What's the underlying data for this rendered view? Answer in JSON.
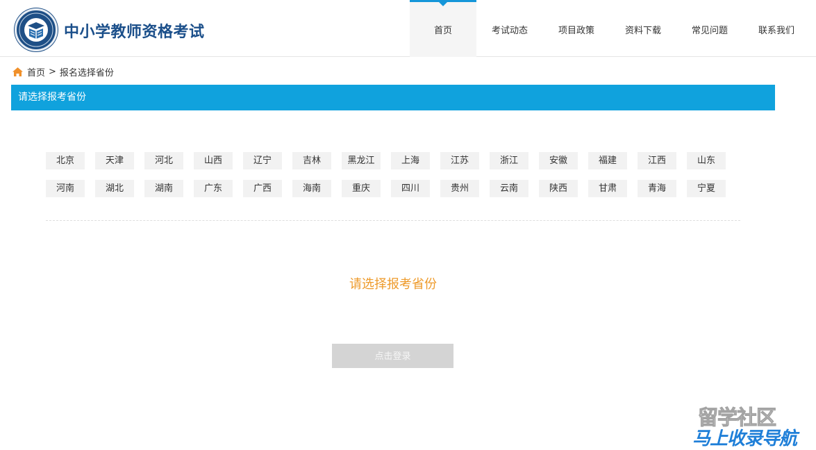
{
  "header": {
    "site_title": "中小学教师资格考试",
    "logo_icon": "book-emblem-icon"
  },
  "nav": {
    "items": [
      {
        "label": "首页",
        "active": true
      },
      {
        "label": "考试动态",
        "active": false
      },
      {
        "label": "项目政策",
        "active": false
      },
      {
        "label": "资料下载",
        "active": false
      },
      {
        "label": "常见问题",
        "active": false
      },
      {
        "label": "联系我们",
        "active": false
      }
    ],
    "accent_color": "#1596d9"
  },
  "breadcrumb": {
    "icon": "home-icon",
    "home": "首页",
    "separator": ">",
    "current": "报名选择省份"
  },
  "section_bar": {
    "title": "请选择报考省份",
    "color": "#10a2dd"
  },
  "provinces": {
    "row1": [
      "北京",
      "天津",
      "河北",
      "山西",
      "辽宁",
      "吉林",
      "黑龙江",
      "上海",
      "江苏",
      "浙江",
      "安徽",
      "福建",
      "江西",
      "山东"
    ],
    "row2": [
      "河南",
      "湖北",
      "湖南",
      "广东",
      "广西",
      "海南",
      "重庆",
      "四川",
      "贵州",
      "云南",
      "陕西",
      "甘肃",
      "青海",
      "宁夏"
    ]
  },
  "prompt": {
    "text": "请选择报考省份",
    "color": "#ee9a2a"
  },
  "login_button": {
    "label": "点击登录"
  },
  "watermark": {
    "line1": "留学社区",
    "line2": "马上收录导航"
  }
}
